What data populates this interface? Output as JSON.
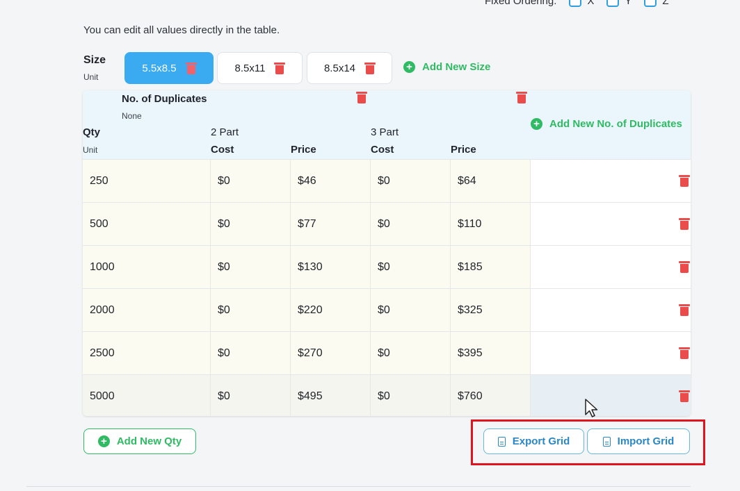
{
  "top": {
    "label": "Fixed Ordering:",
    "options": [
      "X",
      "Y",
      "Z"
    ]
  },
  "hint": "You can edit all values directly in the table.",
  "size": {
    "label": "Size",
    "unit": "Unit",
    "chips": [
      "5.5x8.5",
      "8.5x11",
      "8.5x14"
    ],
    "add_label": "Add New Size"
  },
  "grid": {
    "dup_title": "No. of Duplicates",
    "dup_unit": "None",
    "qty_title": "Qty",
    "qty_unit": "Unit",
    "groups": [
      "2 Part",
      "3 Part"
    ],
    "cols": [
      "Cost",
      "Price",
      "Cost",
      "Price"
    ],
    "add_dup_label": "Add New No. of Duplicates",
    "rows": [
      [
        "250",
        "$0",
        "$46",
        "$0",
        "$64"
      ],
      [
        "500",
        "$0",
        "$77",
        "$0",
        "$110"
      ],
      [
        "1000",
        "$0",
        "$130",
        "$0",
        "$185"
      ],
      [
        "2000",
        "$0",
        "$220",
        "$0",
        "$325"
      ],
      [
        "2500",
        "$0",
        "$270",
        "$0",
        "$395"
      ],
      [
        "5000",
        "$0",
        "$495",
        "$0",
        "$760"
      ]
    ]
  },
  "buttons": {
    "add_qty": "Add New Qty",
    "export": "Export Grid",
    "import": "Import Grid"
  },
  "colors": {
    "accent": "#3aabf0",
    "green": "#2fba63",
    "danger": "#ea4b4b",
    "highlight": "#e0141e"
  }
}
